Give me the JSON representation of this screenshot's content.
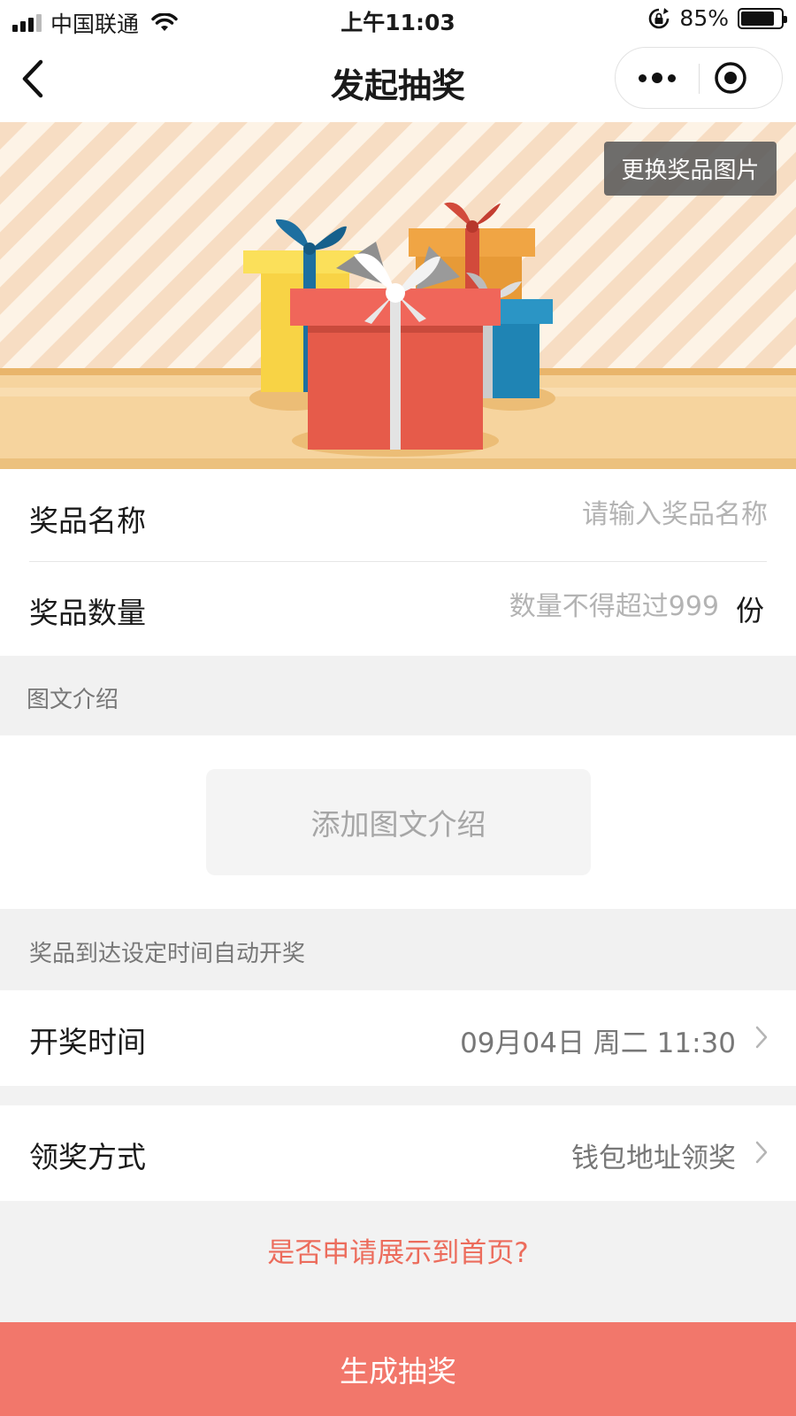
{
  "status_bar": {
    "carrier": "中国联通",
    "time": "上午11:03",
    "battery": "85%",
    "battery_level": 0.85
  },
  "nav": {
    "title": "发起抽奖"
  },
  "banner": {
    "change_image_label": "更换奖品图片"
  },
  "form": {
    "prize_name": {
      "label": "奖品名称",
      "placeholder": "请输入奖品名称",
      "value": ""
    },
    "prize_quantity": {
      "label": "奖品数量",
      "placeholder": "数量不得超过999",
      "value": "",
      "unit": "份"
    }
  },
  "intro_section": {
    "header": "图文介绍",
    "add_label": "添加图文介绍"
  },
  "draw_section": {
    "header": "奖品到达设定时间自动开奖",
    "draw_time": {
      "label": "开奖时间",
      "value": "09月04日 周二 11:30"
    },
    "claim_method": {
      "label": "领奖方式",
      "value": "钱包地址领奖"
    }
  },
  "apply_link": "是否申请展示到首页?",
  "submit_label": "生成抽奖",
  "colors": {
    "accent": "#f2776b",
    "link": "#ec6c5c",
    "background": "#f2f2f2"
  },
  "icons": [
    "signal-icon",
    "wifi-icon",
    "orientation-lock-icon",
    "battery-icon",
    "back-arrow-icon",
    "more-icon",
    "close-miniprogram-icon",
    "chevron-right-icon"
  ]
}
